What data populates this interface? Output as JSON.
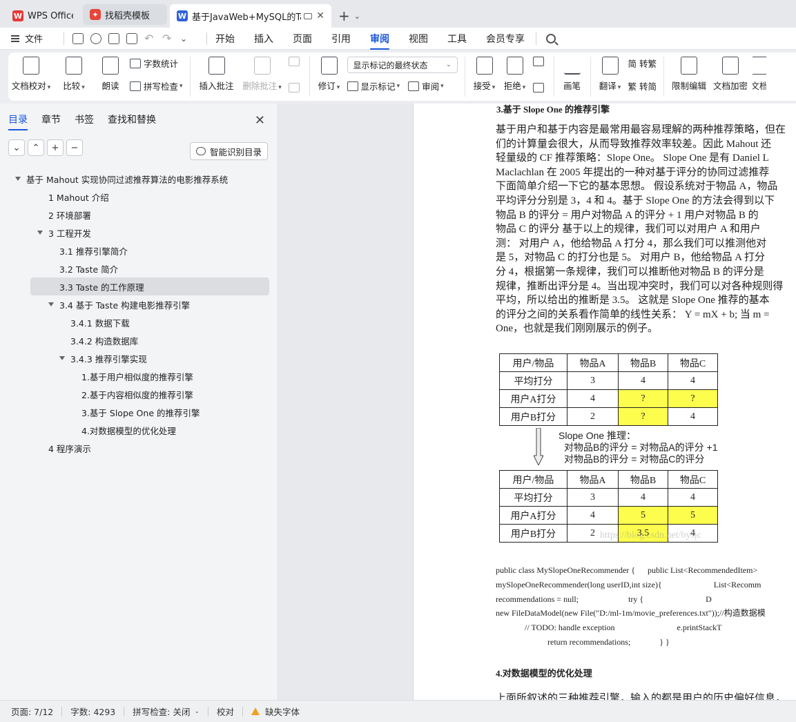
{
  "tabs": [
    {
      "label": "WPS Office",
      "icon": "wps-logo-icon"
    },
    {
      "label": "找稻壳模板",
      "icon": "docer-logo-icon"
    },
    {
      "label": "基于JavaWeb+MySQL的Tast",
      "icon": "word-doc-icon"
    }
  ],
  "menubar": {
    "file": "文件",
    "items": [
      "开始",
      "插入",
      "页面",
      "引用",
      "审阅",
      "视图",
      "工具",
      "会员专享"
    ],
    "active": "审阅"
  },
  "ribbon": {
    "doc_check": "文档校对",
    "compare": "比较",
    "read_aloud": "朗读",
    "word_count": "字数统计",
    "spell_check": "拼写检查",
    "insert_comment": "插入批注",
    "delete_comment": "删除批注",
    "revise": "修订",
    "markup_state": "显示标记的最终状态",
    "show_markup": "显示标记",
    "review": "审阅",
    "accept": "接受",
    "reject": "拒绝",
    "pen": "画笔",
    "translate": "翻译",
    "to_traditional": "简 转繁",
    "to_simplified": "繁 转简",
    "restrict_edit": "限制编辑",
    "doc_encrypt": "文档加密",
    "doc_more": "文档"
  },
  "nav": {
    "tabs": [
      "目录",
      "章节",
      "书签",
      "查找和替换"
    ],
    "smart_toc": "智能识别目录",
    "toc": [
      {
        "text": "基于 Mahout 实现协同过滤推荐算法的电影推荐系统",
        "level": 0,
        "expand": true
      },
      {
        "text": "1 Mahout 介绍",
        "level": 1,
        "expand": false
      },
      {
        "text": "2 环境部署",
        "level": 1,
        "expand": false
      },
      {
        "text": "3 工程开发",
        "level": 1,
        "expand": true
      },
      {
        "text": "3.1 推荐引擎简介",
        "level": 2,
        "expand": false
      },
      {
        "text": "3.2 Taste 简介",
        "level": 2,
        "expand": false
      },
      {
        "text": "3.3 Taste 的工作原理",
        "level": 2,
        "expand": false,
        "selected": true
      },
      {
        "text": "3.4 基于 Taste 构建电影推荐引擎",
        "level": 2,
        "expand": true
      },
      {
        "text": "3.4.1 数据下载",
        "level": 3,
        "expand": false
      },
      {
        "text": "3.4.2 构造数据库",
        "level": 3,
        "expand": false
      },
      {
        "text": "3.4.3 推荐引擎实现",
        "level": 3,
        "expand": true
      },
      {
        "text": "1.基于用户相似度的推荐引擎",
        "level": 4,
        "expand": false
      },
      {
        "text": "2.基于内容相似度的推荐引擎",
        "level": 4,
        "expand": false
      },
      {
        "text": "3.基于 Slope One 的推荐引擎",
        "level": 4,
        "expand": false
      },
      {
        "text": "4.对数据模型的优化处理",
        "level": 4,
        "expand": false
      },
      {
        "text": "4 程序演示",
        "level": 1,
        "expand": false
      }
    ]
  },
  "document": {
    "heading": "3.基于 Slope One 的推荐引擎",
    "paragraph": [
      "基于用户和基于内容是最常用最容易理解的两种推荐策略，但在",
      "们的计算量会很大，从而导致推荐效率较差。因此 Mahout 还",
      "轻量级的 CF 推荐策略：Slope One。 Slope One 是有 Daniel L",
      "Maclachlan 在 2005 年提出的一种对基于评分的协同过滤推荐",
      "下面简单介绍一下它的基本思想。 假设系统对于物品 A，物品",
      "平均评分分别是 3，4 和 4。基于 Slope One 的方法会得到以下",
      "物品 B 的评分 = 用户对物品 A 的评分 + 1 用户对物品 B 的",
      "物品 C 的评分 基于以上的规律，我们可以对用户 A 和用户",
      "测： 对用户 A，他给物品 A 打分 4，那么我们可以推测他对",
      "是 5，对物品 C 的打分也是 5。 对用户 B，他给物品 A 打分",
      "分 4，根据第一条规律，我们可以推断他对物品 B 的评分是",
      "规律，推断出评分是 4。当出现冲突时，我们可以对各种规则得",
      "平均，所以给出的推断是 3.5。 这就是 Slope One 推荐的基本",
      "的评分之间的关系看作简单的线性关系： Y = mX + b; 当 m =",
      "One，也就是我们刚刚展示的例子。"
    ],
    "table1": {
      "header": [
        "用户/物品",
        "物品A",
        "物品B",
        "物品C"
      ],
      "rows": [
        [
          "平均打分",
          "3",
          "4",
          "4"
        ],
        [
          "用户A打分",
          "4",
          "?",
          "?"
        ],
        [
          "用户B打分",
          "2",
          "?",
          "4"
        ]
      ]
    },
    "note": {
      "title": "Slope One 推理：",
      "line1": "对物品B的评分 = 对物品A的评分 +1",
      "line2": "对物品B的评分 = 对物品C的评分"
    },
    "table2": {
      "header": [
        "用户/物品",
        "物品A",
        "物品B",
        "物品C"
      ],
      "rows": [
        [
          "平均打分",
          "3",
          "4",
          "4"
        ],
        [
          "用户A打分",
          "4",
          "5",
          "5"
        ],
        [
          "用户B打分",
          "2",
          "3.5",
          "4"
        ]
      ]
    },
    "watermark": "https://blog.csdn.net/bysjc",
    "code": [
      "public class MySlopeOneRecommender {      public List<RecommendedItem>",
      "mySlopeOneRecommender(long userID,int size){                         List<Recomm",
      "recommendations = null;                        try {                              D",
      "new FileDataModel(new File(\"D:/ml-1m/movie_preferences.txt\"));//构造数据模",
      "              // TODO: handle exception                              e.printStackT",
      "                         return recommendations;              } }"
    ],
    "heading2": "4.对数据模型的优化处理",
    "last_line": "上面所叙述的三种推荐引擎，输入的都是用户的历史偏好信息，"
  },
  "status": {
    "page": "页面: 7/12",
    "words": "字数: 4293",
    "spell": "拼写检查: 关闭",
    "proof": "校对",
    "missing_font": "缺失字体"
  },
  "colors": {
    "accent": "#1a56db",
    "highlight": "#fdfd4e",
    "warning": "#f0a020"
  }
}
